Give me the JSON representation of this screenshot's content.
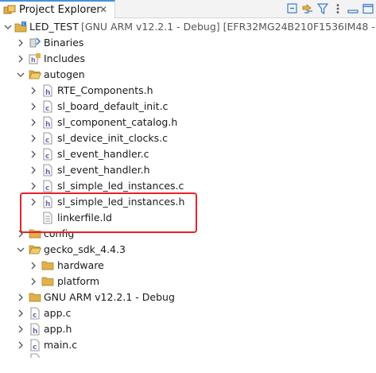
{
  "tab": {
    "title": "Project Explorer",
    "close": "✕"
  },
  "toolbar": {
    "collapse_all": "collapse-all",
    "link_editor": "link-with-editor",
    "filter": "filter",
    "menu": "view-menu",
    "minimize": "minimize",
    "maximize": "maximize"
  },
  "tree": {
    "project": {
      "name": "LED_TEST",
      "detail": "[GNU ARM v12.2.1 - Debug] [EFR32MG24B210F1536IM48 - G"
    },
    "binaries": "Binaries",
    "includes": "Includes",
    "autogen": "autogen",
    "autogen_files": [
      "RTE_Components.h",
      "sl_board_default_init.c",
      "sl_component_catalog.h",
      "sl_device_init_clocks.c",
      "sl_event_handler.c",
      "sl_event_handler.h",
      "sl_simple_led_instances.c",
      "sl_simple_led_instances.h",
      "linkerfile.ld"
    ],
    "config": "config",
    "gecko_sdk": "gecko_sdk_4.4.3",
    "hardware": "hardware",
    "platform": "platform",
    "gnu_arm": "GNU ARM v12.2.1 - Debug",
    "root_files": [
      "app.c",
      "app.h",
      "main.c"
    ]
  },
  "colors": {
    "highlight": "#e8212b",
    "folder": "#e0b24a",
    "c_file": "#5b6fb0",
    "h_file": "#7a5ca8"
  }
}
